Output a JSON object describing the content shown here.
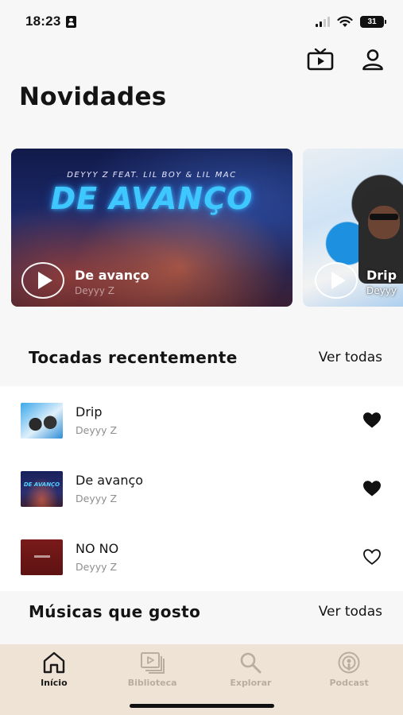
{
  "status_bar": {
    "time": "18:23",
    "battery": "31"
  },
  "header": {
    "title": "Novidades",
    "icons": [
      "tv-icon",
      "profile-icon"
    ]
  },
  "featured": [
    {
      "cover_artists": "DEYYY Z FEAT. LIL BOY & LIL MAC",
      "cover_logo": "DE AVANÇO",
      "title": "De avanço",
      "artist": "Deyyy Z"
    },
    {
      "title": "Drip",
      "artist": "Deyyy"
    }
  ],
  "recent": {
    "title": "Tocadas recentemente",
    "see_all": "Ver todas",
    "tracks": [
      {
        "title": "Drip",
        "artist": "Deyyy Z",
        "liked": true
      },
      {
        "title": "De avanço",
        "artist": "Deyyy Z",
        "liked": true
      },
      {
        "title": "NO NO",
        "artist": "Deyyy Z",
        "liked": false
      }
    ]
  },
  "liked_section": {
    "title": "Músicas que gosto",
    "see_all": "Ver todas"
  },
  "nav": {
    "items": [
      {
        "label": "Início",
        "icon": "home-icon",
        "active": true
      },
      {
        "label": "Biblioteca",
        "icon": "library-icon",
        "active": false
      },
      {
        "label": "Explorar",
        "icon": "search-icon",
        "active": false
      },
      {
        "label": "Podcast",
        "icon": "podcast-icon",
        "active": false
      }
    ]
  },
  "colors": {
    "nav_background": "#efe3d6",
    "nav_inactive": "#b9ada1",
    "accent_logo": "#3ec8ff"
  }
}
